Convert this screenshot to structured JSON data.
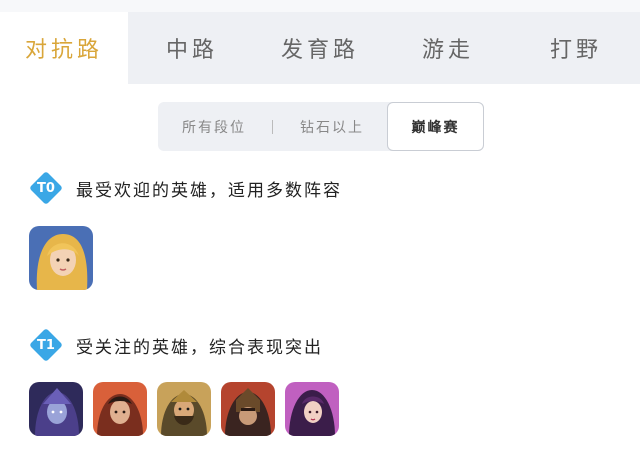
{
  "tabs": [
    {
      "label": "对抗路",
      "active": true
    },
    {
      "label": "中路",
      "active": false
    },
    {
      "label": "发育路",
      "active": false
    },
    {
      "label": "游走",
      "active": false
    },
    {
      "label": "打野",
      "active": false
    }
  ],
  "segments": [
    {
      "label": "所有段位",
      "active": false
    },
    {
      "label": "钻石以上",
      "active": false
    },
    {
      "label": "巅峰赛",
      "active": true
    }
  ],
  "tiers": [
    {
      "badge": "T0",
      "description": "最受欢迎的英雄，适用多数阵容",
      "heroes": [
        {
          "icon": "hero-portrait-blonde-female",
          "colors": [
            "#f1c45a",
            "#4a6fb5"
          ]
        }
      ]
    },
    {
      "badge": "T1",
      "description": "受关注的英雄，综合表现突出",
      "heroes": [
        {
          "icon": "hero-portrait-purple-armored",
          "colors": [
            "#4b3f8a",
            "#9aa3d8"
          ]
        },
        {
          "icon": "hero-portrait-red-warrior",
          "colors": [
            "#7a2e1e",
            "#d9603a"
          ]
        },
        {
          "icon": "hero-portrait-bearded-general",
          "colors": [
            "#5a4a2a",
            "#c8a25a"
          ]
        },
        {
          "icon": "hero-portrait-dark-helmet",
          "colors": [
            "#3a2420",
            "#b5442e"
          ]
        },
        {
          "icon": "hero-portrait-purple-female",
          "colors": [
            "#3b1d4a",
            "#c060c0"
          ]
        }
      ]
    }
  ],
  "colors": {
    "accent": "#d9a63a",
    "tier_badge": "#3aa7e6",
    "tab_bar": "#eef0f4"
  }
}
